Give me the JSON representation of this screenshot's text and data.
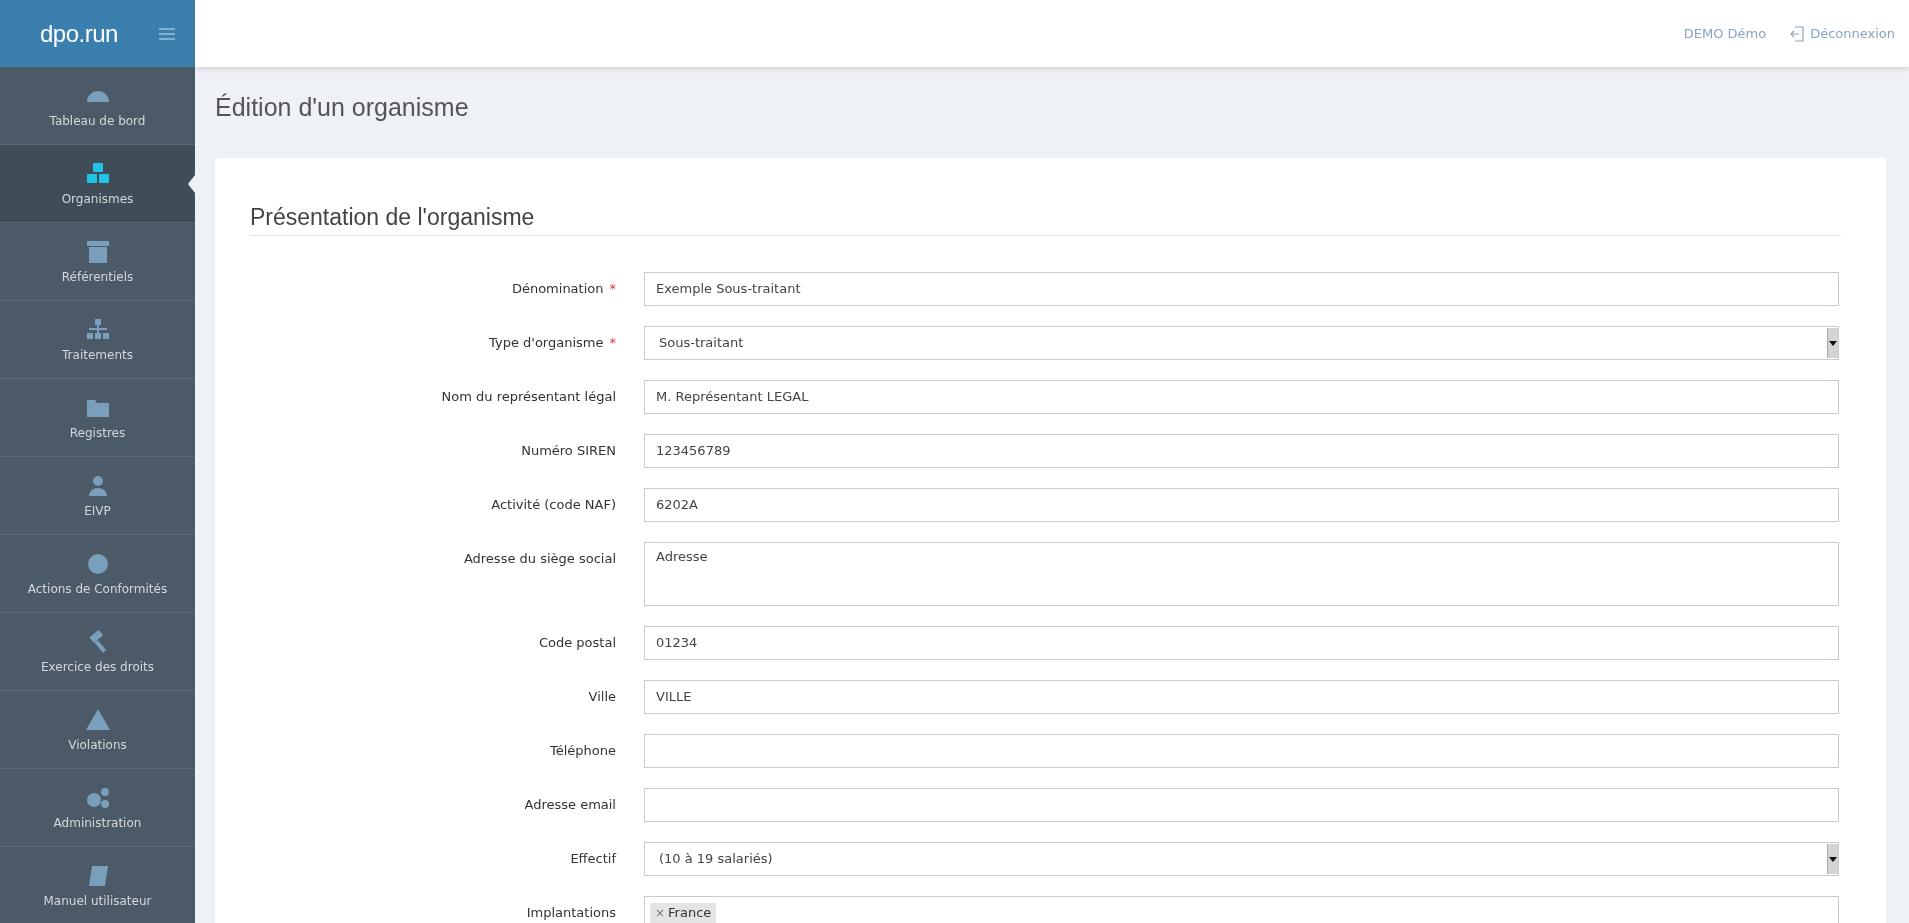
{
  "logo": "dpo.run",
  "sidebar": {
    "items": [
      {
        "label": "Tableau de bord",
        "selected": false
      },
      {
        "label": "Organismes",
        "selected": true
      },
      {
        "label": "Référentiels",
        "selected": false
      },
      {
        "label": "Traitements",
        "selected": false
      },
      {
        "label": "Registres",
        "selected": false
      },
      {
        "label": "EIVP",
        "selected": false
      },
      {
        "label": "Actions de Conformités",
        "selected": false
      },
      {
        "label": "Exercice des droits",
        "selected": false
      },
      {
        "label": "Violations",
        "selected": false
      },
      {
        "label": "Administration",
        "selected": false
      },
      {
        "label": "Manuel utilisateur",
        "selected": false
      }
    ]
  },
  "header": {
    "user": "DEMO Démo",
    "logout": "Déconnexion"
  },
  "page_title": "Édition d'un organisme",
  "section_title": "Présentation de l'organisme",
  "fields": [
    {
      "label": "Dénomination",
      "required_mark": "*",
      "kind": "text",
      "value": "Exemple Sous-traitant"
    },
    {
      "label": "Type d'organisme",
      "required_mark": "*",
      "kind": "select",
      "value": "Sous-traitant"
    },
    {
      "label": "Nom du représentant légal",
      "kind": "text",
      "value": "M. Représentant LEGAL"
    },
    {
      "label": "Numéro SIREN",
      "kind": "text",
      "value": "123456789"
    },
    {
      "label": "Activité (code NAF)",
      "kind": "text",
      "value": "6202A"
    },
    {
      "label": "Adresse du siège social",
      "kind": "textarea",
      "value": "Adresse"
    },
    {
      "label": "Code postal",
      "kind": "text",
      "value": "01234"
    },
    {
      "label": "Ville",
      "kind": "text",
      "value": "VILLE"
    },
    {
      "label": "Téléphone",
      "kind": "text"
    },
    {
      "label": "Adresse email",
      "kind": "text"
    },
    {
      "label": "Effectif",
      "kind": "select",
      "value": "(10 à 19 salariés)"
    },
    {
      "label": "Implantations",
      "kind": "tags",
      "tags": [
        {
          "remove": "×",
          "label": "France"
        }
      ]
    }
  ]
}
